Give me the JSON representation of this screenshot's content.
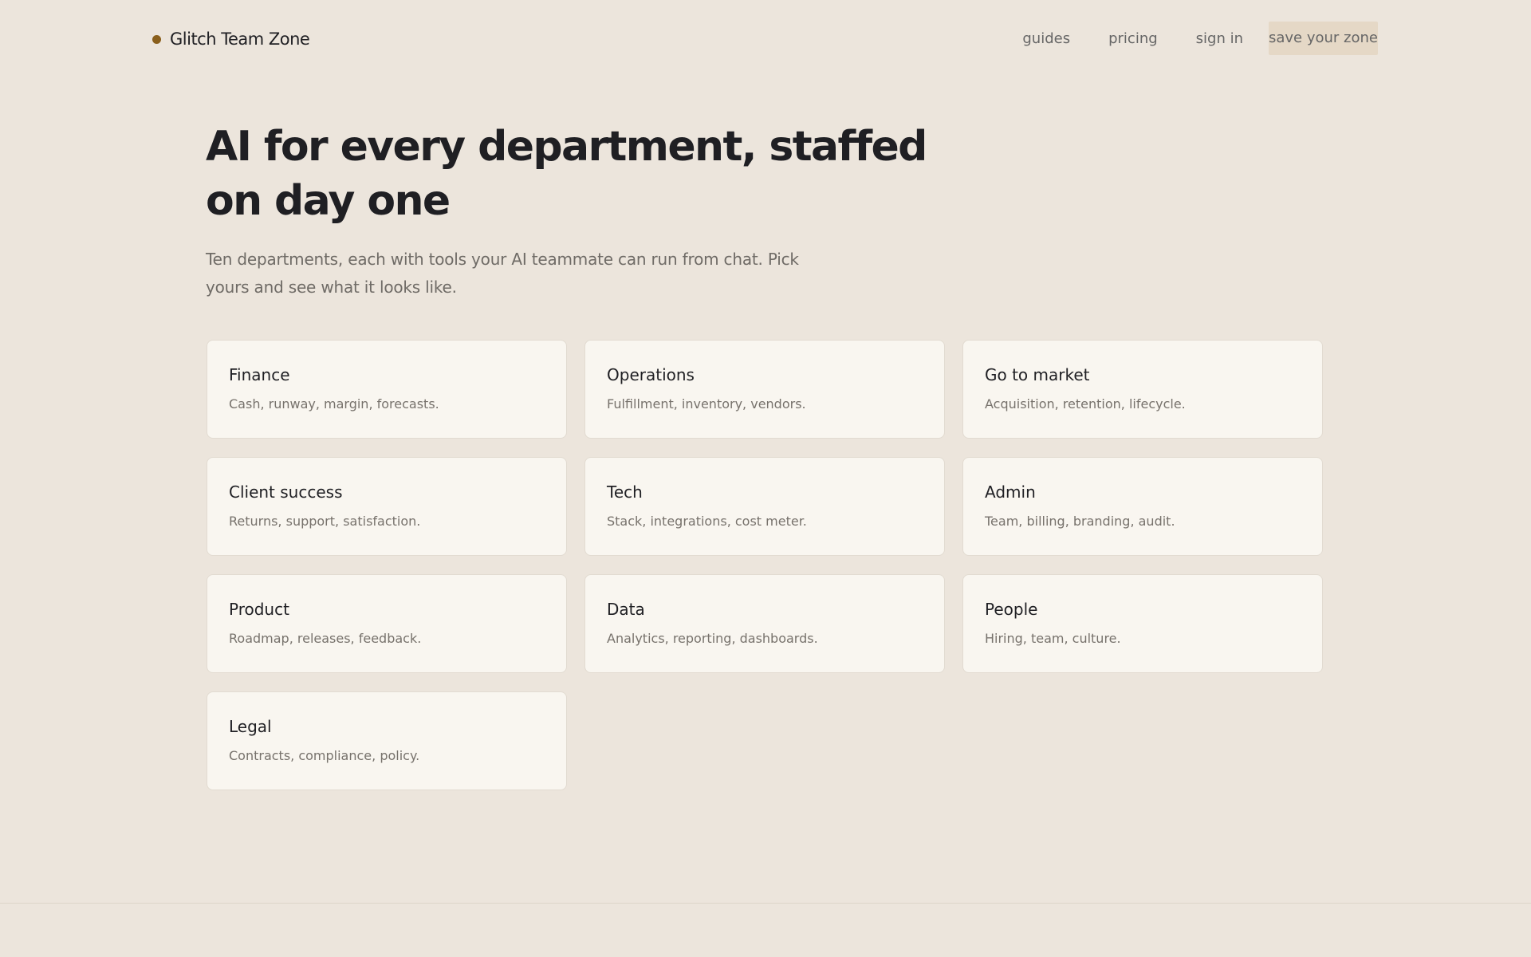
{
  "brand": {
    "name": "Glitch Team Zone"
  },
  "nav": {
    "guides": "guides",
    "pricing": "pricing",
    "sign_in": "sign in",
    "cta": "save your zone"
  },
  "hero": {
    "title": "AI for every department, staffed on day one",
    "subtitle": "Ten departments, each with tools your AI teammate can run from chat. Pick yours and see what it looks like."
  },
  "departments": [
    {
      "title": "Finance",
      "description": "Cash, runway, margin, forecasts."
    },
    {
      "title": "Operations",
      "description": "Fulfillment, inventory, vendors."
    },
    {
      "title": "Go to market",
      "description": "Acquisition, retention, lifecycle."
    },
    {
      "title": "Client success",
      "description": "Returns, support, satisfaction."
    },
    {
      "title": "Tech",
      "description": "Stack, integrations, cost meter."
    },
    {
      "title": "Admin",
      "description": "Team, billing, branding, audit."
    },
    {
      "title": "Product",
      "description": "Roadmap, releases, feedback."
    },
    {
      "title": "Data",
      "description": "Analytics, reporting, dashboards."
    },
    {
      "title": "People",
      "description": "Hiring, team, culture."
    },
    {
      "title": "Legal",
      "description": "Contracts, compliance, policy."
    }
  ],
  "colors": {
    "background": "#ece5dc",
    "accent": "#8a5f1c",
    "cta_background": "#e5d8c6",
    "card_background": "#f9f6f0"
  }
}
